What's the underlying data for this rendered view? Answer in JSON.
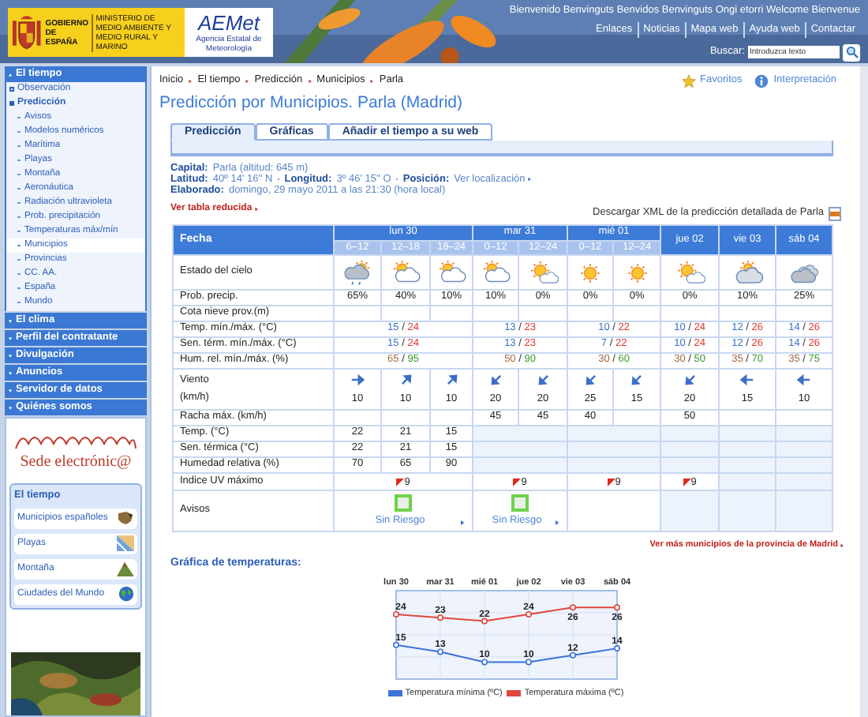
{
  "header": {
    "government": "GOBIERNO DE ESPAÑA",
    "ministry": "MINISTERIO DE MEDIO AMBIENTE Y MEDIO RURAL Y MARINO",
    "agency_logo": "AEMet",
    "agency": "Agencia Estatal de Meteorología",
    "welcome": "Bienvenido Benvinguts Benvidos Benvinguts Ongi etorri Welcome Bienvenue",
    "links": [
      "Enlaces",
      "Noticias",
      "Mapa web",
      "Ayuda web",
      "Contactar"
    ],
    "search": {
      "label": "Buscar:",
      "placeholder": "Introduzca texto"
    }
  },
  "sidebar": {
    "sections": [
      {
        "label": "El tiempo",
        "expanded": true,
        "items": [
          {
            "label": "Observación",
            "selected": false
          },
          {
            "label": "Predicción",
            "selected": true,
            "children": [
              {
                "label": "Avisos",
                "selected": false
              },
              {
                "label": "Modelos numéricos",
                "selected": false
              },
              {
                "label": "Marítima",
                "selected": false
              },
              {
                "label": "Playas",
                "selected": false
              },
              {
                "label": "Montaña",
                "selected": false
              },
              {
                "label": "Aeronáutica",
                "selected": false
              },
              {
                "label": "Radiación ultravioleta",
                "selected": false
              },
              {
                "label": "Prob. precipitación",
                "selected": false
              },
              {
                "label": "Temperaturas máx/mín",
                "selected": false
              },
              {
                "label": "Municipios",
                "selected": true
              },
              {
                "label": "Provincias",
                "selected": false
              },
              {
                "label": "CC. AA.",
                "selected": false
              },
              {
                "label": "España",
                "selected": false
              },
              {
                "label": "Mundo",
                "selected": false
              }
            ]
          }
        ]
      },
      {
        "label": "El clima",
        "expanded": false
      },
      {
        "label": "Perfil del contratante",
        "expanded": false
      },
      {
        "label": "Divulgación",
        "expanded": false
      },
      {
        "label": "Anuncios",
        "expanded": false
      },
      {
        "label": "Servidor de datos",
        "expanded": false
      },
      {
        "label": "Quiénes somos",
        "expanded": false
      }
    ],
    "sede": "Sede electrónic@",
    "quick_links": {
      "title": "El tiempo",
      "items": [
        {
          "label": "Municipios españoles",
          "kind": "map"
        },
        {
          "label": "Playas",
          "kind": "beach"
        },
        {
          "label": "Montaña",
          "kind": "mountain"
        },
        {
          "label": "Ciudades del Mundo",
          "kind": "globe"
        }
      ]
    }
  },
  "breadcrumb": [
    "Inicio",
    "El tiempo",
    "Predicción",
    "Municipios",
    "Parla"
  ],
  "actions": [
    {
      "label": "Favoritos",
      "kind": "star"
    },
    {
      "label": "Interpretación",
      "kind": "info"
    }
  ],
  "title": "Predicción por Municipios. Parla (Madrid)",
  "tabs": [
    {
      "label": "Predicción",
      "selected": true
    },
    {
      "label": "Gráficas",
      "selected": false
    },
    {
      "label": "Añadir el tiempo a su web",
      "selected": false
    }
  ],
  "info": [
    [
      {
        "label": "Capital:",
        "value": "Parla (altitud: 645 m)",
        "link": false
      }
    ],
    [
      {
        "label": "Latitud:",
        "value": "40º 14' 16'' N",
        "link": false
      },
      {
        "label": "Longitud:",
        "value": "3º 46' 15'' O",
        "link": false
      },
      {
        "label": "Posición:",
        "value": "Ver localización",
        "link": true
      }
    ],
    [
      {
        "label": "Elaborado:",
        "value": "domingo, 29 mayo 2011 a las 21:30 (hora local)",
        "link": false
      }
    ]
  ],
  "reduced_table_link": "Ver tabla reducida",
  "xml_link": "Descargar XML de la predicción detallada de Parla",
  "forecast": {
    "header_label": "Fecha",
    "days": [
      {
        "label": "lun 30",
        "periods": [
          "6–12",
          "12–18",
          "18–24"
        ]
      },
      {
        "label": "mar 31",
        "periods": [
          "0–12",
          "12–24"
        ]
      },
      {
        "label": "mié 01",
        "periods": [
          "0–12",
          "12–24"
        ]
      },
      {
        "label": "jue 02"
      },
      {
        "label": "vie 03"
      },
      {
        "label": "sáb 04"
      }
    ],
    "rows": [
      {
        "label": "Estado del cielo",
        "kind": "sky",
        "days": [
          [
            {
              "kind": "rain"
            },
            {
              "kind": "partly"
            },
            {
              "kind": "partly"
            }
          ],
          [
            {
              "kind": "partly"
            },
            {
              "kind": "mostly_sunny"
            }
          ],
          [
            {
              "kind": "sunny"
            },
            {
              "kind": "sunny"
            }
          ],
          [
            {
              "kind": "mostly_sunny"
            }
          ],
          [
            {
              "kind": "cloudy_sun"
            }
          ],
          [
            {
              "kind": "overcast"
            }
          ]
        ]
      },
      {
        "label": "Prob. precip.",
        "kind": "text",
        "days": [
          [
            {
              "text": "65%"
            },
            {
              "text": "40%"
            },
            {
              "text": "10%"
            }
          ],
          [
            {
              "text": "10%"
            },
            {
              "text": "0%"
            }
          ],
          [
            {
              "text": "0%"
            },
            {
              "text": "0%"
            }
          ],
          [
            {
              "text": "0%"
            }
          ],
          [
            {
              "text": "10%"
            }
          ],
          [
            {
              "text": "25%"
            }
          ]
        ]
      },
      {
        "label": "Cota nieve prov.(m)",
        "kind": "text",
        "days": [
          [
            {
              "shaded": false
            },
            {
              "shaded": false
            },
            {
              "shaded": false
            }
          ],
          [
            {
              "shaded": false
            },
            {
              "shaded": false
            }
          ],
          [
            {
              "shaded": false
            },
            {
              "shaded": false
            }
          ],
          [
            {
              "shaded": false
            }
          ],
          [
            {
              "shaded": false
            }
          ],
          [
            {
              "shaded": false
            }
          ]
        ]
      },
      {
        "label": "Temp. mín./máx. (°C)",
        "kind": "temperature",
        "separator": "/",
        "days": [
          [
            {
              "min": "15",
              "max": "24"
            }
          ],
          [
            {
              "min": "13",
              "max": "23"
            }
          ],
          [
            {
              "min": "10",
              "max": "22"
            }
          ],
          [
            {
              "min": "10",
              "max": "24"
            }
          ],
          [
            {
              "min": "12",
              "max": "26"
            }
          ],
          [
            {
              "min": "14",
              "max": "26"
            }
          ]
        ]
      },
      {
        "label": "Sen. térm. mín./máx. (°C)",
        "kind": "temperature",
        "separator": "/",
        "days": [
          [
            {
              "min": "15",
              "max": "24"
            }
          ],
          [
            {
              "min": "13",
              "max": "23"
            }
          ],
          [
            {
              "min": "7",
              "max": "22"
            }
          ],
          [
            {
              "min": "10",
              "max": "24"
            }
          ],
          [
            {
              "min": "12",
              "max": "26"
            }
          ],
          [
            {
              "min": "14",
              "max": "26"
            }
          ]
        ]
      },
      {
        "label": "Hum. rel. mín./máx. (%)",
        "kind": "humidity",
        "separator": "/",
        "days": [
          [
            {
              "min": "65",
              "max": "95"
            }
          ],
          [
            {
              "min": "50",
              "max": "90"
            }
          ],
          [
            {
              "min": "30",
              "max": "60"
            }
          ],
          [
            {
              "min": "30",
              "max": "50"
            }
          ],
          [
            {
              "min": "35",
              "max": "70"
            }
          ],
          [
            {
              "min": "35",
              "max": "75"
            }
          ]
        ]
      },
      {
        "label": "Viento",
        "sublabel": "(km/h)",
        "kind": "wind",
        "days": [
          [
            {
              "kind": "E",
              "speed": "10"
            },
            {
              "kind": "NE",
              "speed": "10"
            },
            {
              "kind": "NE",
              "speed": "10"
            }
          ],
          [
            {
              "kind": "SW",
              "speed": "20"
            },
            {
              "kind": "SW",
              "speed": "20"
            }
          ],
          [
            {
              "kind": "SW",
              "speed": "25"
            },
            {
              "kind": "SW",
              "speed": "15"
            }
          ],
          [
            {
              "kind": "SW",
              "speed": "20"
            }
          ],
          [
            {
              "kind": "W",
              "speed": "15"
            }
          ],
          [
            {
              "kind": "W",
              "speed": "10"
            }
          ]
        ]
      },
      {
        "label": "Racha máx. (km/h)",
        "kind": "text",
        "days": [
          [
            {
              "shaded": false
            },
            {
              "shaded": false
            },
            {
              "shaded": false
            }
          ],
          [
            {
              "text": "45"
            },
            {
              "text": "45"
            }
          ],
          [
            {
              "text": "40"
            },
            {
              "shaded": false
            }
          ],
          [
            {
              "text": "50"
            }
          ],
          [
            {
              "shaded": false
            }
          ],
          [
            {
              "shaded": false
            }
          ]
        ]
      },
      {
        "label": "Temp. (°C)",
        "kind": "text",
        "days": [
          [
            {
              "text": "22"
            },
            {
              "text": "21"
            },
            {
              "text": "15"
            }
          ],
          [
            {
              "shaded": true
            }
          ],
          [
            {
              "shaded": true
            }
          ],
          [
            {
              "shaded": true
            }
          ],
          [
            {
              "shaded": true
            }
          ],
          [
            {
              "shaded": true
            }
          ]
        ]
      },
      {
        "label": "Sen. térmica (°C)",
        "kind": "text",
        "days": [
          [
            {
              "text": "22"
            },
            {
              "text": "21"
            },
            {
              "text": "15"
            }
          ],
          [
            {
              "shaded": true
            }
          ],
          [
            {
              "shaded": true
            }
          ],
          [
            {
              "shaded": true
            }
          ],
          [
            {
              "shaded": true
            }
          ],
          [
            {
              "shaded": true
            }
          ]
        ]
      },
      {
        "label": "Humedad relativa (%)",
        "kind": "text",
        "days": [
          [
            {
              "text": "70"
            },
            {
              "text": "65"
            },
            {
              "text": "90"
            }
          ],
          [
            {
              "shaded": true
            }
          ],
          [
            {
              "shaded": true
            }
          ],
          [
            {
              "shaded": true
            }
          ],
          [
            {
              "shaded": true
            }
          ],
          [
            {
              "shaded": true
            }
          ]
        ]
      },
      {
        "label": "Indice UV máximo",
        "kind": "uv",
        "days": [
          [
            {
              "uv": "9"
            }
          ],
          [
            {
              "uv": "9"
            }
          ],
          [
            {
              "uv": "9"
            }
          ],
          [
            {
              "uv": "9"
            }
          ],
          [
            {
              "shaded": true
            }
          ],
          [
            {
              "shaded": true
            }
          ]
        ]
      },
      {
        "label": "Avisos",
        "kind": "warning",
        "days": [
          [
            {
              "text": "Sin Riesgo"
            }
          ],
          [
            {
              "text": "Sin Riesgo"
            }
          ],
          [
            {
              "shaded": false
            }
          ],
          [
            {
              "shaded": true
            }
          ],
          [
            {
              "shaded": true
            }
          ],
          [
            {
              "shaded": true
            }
          ]
        ]
      }
    ]
  },
  "more_link": "Ver más municipios de la provincia de Madrid",
  "chart_title": "Gráfica de temperaturas:",
  "chart_data": {
    "type": "line",
    "categories": [
      "lun 30",
      "mar 31",
      "mié 01",
      "jue 02",
      "vie 03",
      "sáb 04"
    ],
    "ylim": [
      5,
      30
    ],
    "grid": true,
    "data_labels": true,
    "series": [
      {
        "name": "Temperatura mínima (ºC)",
        "color": "#3b73d9",
        "marker": true,
        "values": [
          15,
          13,
          10,
          10,
          12,
          14
        ]
      },
      {
        "name": "Temperatura máxima (ºC)",
        "color": "#e0473d",
        "marker": true,
        "values": [
          24,
          23,
          22,
          24,
          26,
          26
        ]
      }
    ]
  }
}
